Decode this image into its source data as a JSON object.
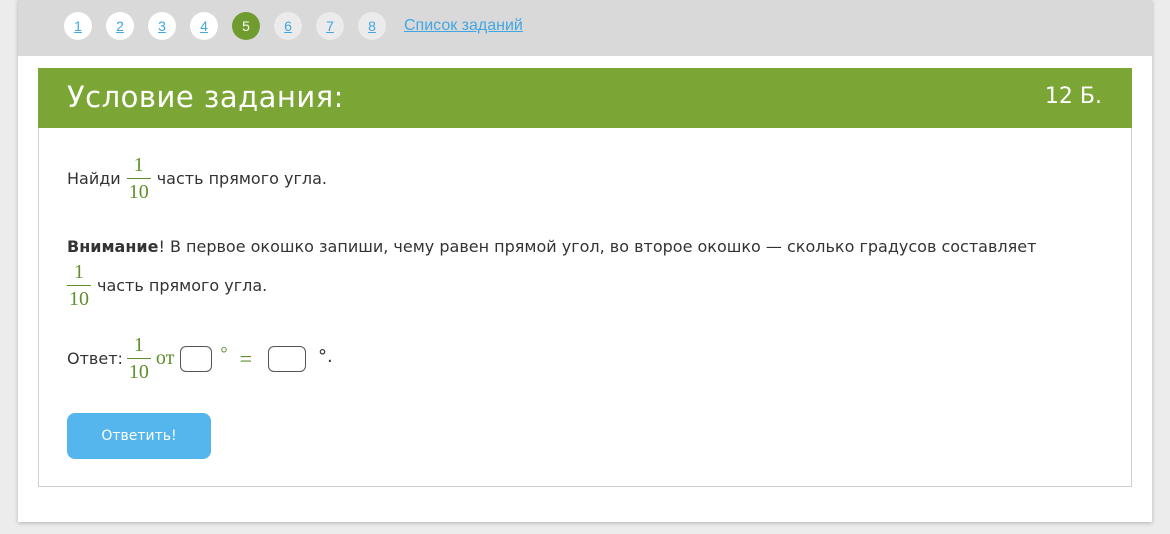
{
  "pager": {
    "pages": [
      {
        "label": "1",
        "state": "normal"
      },
      {
        "label": "2",
        "state": "normal"
      },
      {
        "label": "3",
        "state": "normal"
      },
      {
        "label": "4",
        "state": "normal"
      },
      {
        "label": "5",
        "state": "active"
      },
      {
        "label": "6",
        "state": "muted"
      },
      {
        "label": "7",
        "state": "muted"
      },
      {
        "label": "8",
        "state": "muted"
      }
    ],
    "task_list_label": "Список заданий"
  },
  "task": {
    "title": "Условие задания:",
    "points": "12 Б.",
    "line1_prefix": "Найди",
    "line1_suffix": "часть прямого угла.",
    "fraction": {
      "numerator": "1",
      "denominator": "10"
    },
    "attention_bold": "Внимание",
    "attention_text": "! В первое окошко запиши, чему равен прямой угол, во второе окошко — сколько градусов составляет",
    "attention_suffix": "часть прямого угла.",
    "answer_label": "Ответ:",
    "answer_of": "от",
    "answer_degree1": "°",
    "answer_equals": "=",
    "answer_degree2": "°.",
    "answer_input1_value": "",
    "answer_input2_value": "",
    "submit_label": "Ответить!"
  },
  "colors": {
    "accent_green": "#7ba535",
    "active_page": "#6f9b2f",
    "link_blue": "#42a6e2",
    "button_blue": "#55b6ee"
  }
}
